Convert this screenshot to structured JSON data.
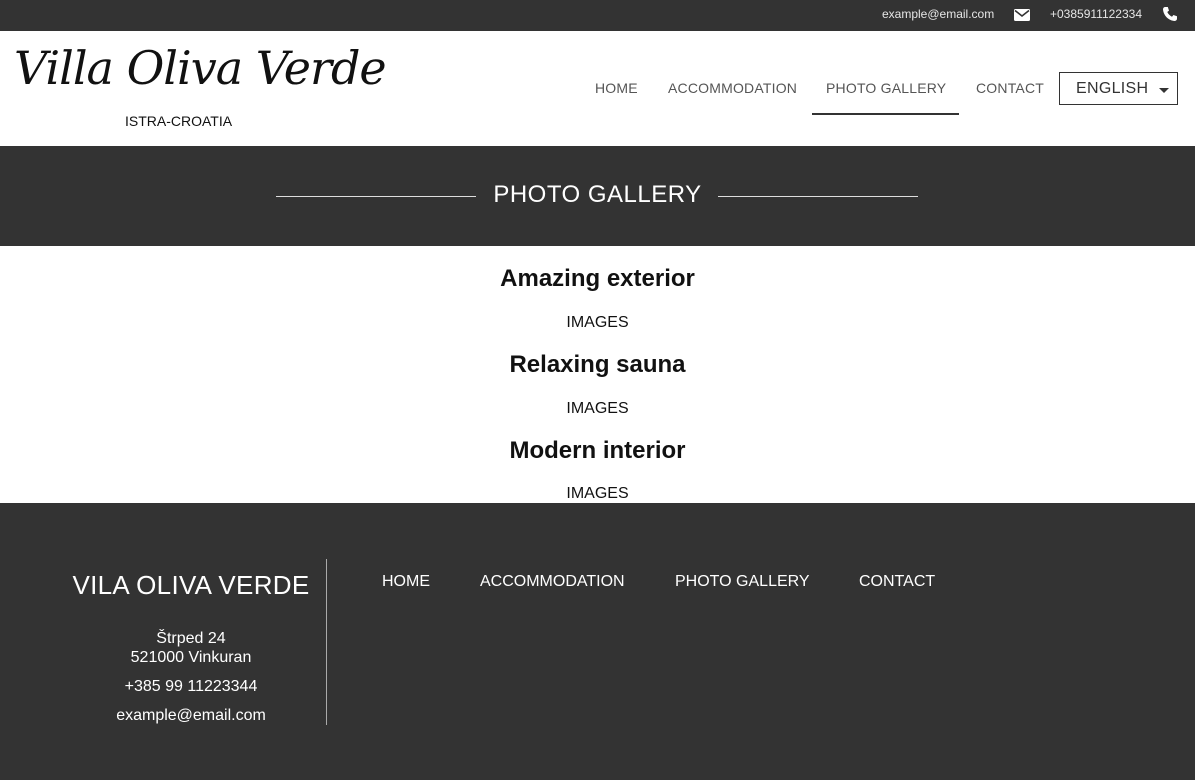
{
  "topbar": {
    "email": "example@email.com",
    "email_icon": "envelope-icon",
    "phone": "+0385911122334",
    "phone_icon": "phone-icon"
  },
  "header": {
    "logo": "Villa Oliva Verde",
    "logo_subtitle": "ISTRA-CROATIA",
    "nav": {
      "home": "HOME",
      "accommodation": "ACCOMMODATION",
      "gallery": "PHOTO GALLERY",
      "contact": "CONTACT",
      "active": "PHOTO GALLERY"
    },
    "language": {
      "selected": "ENGLISH",
      "icon": "chevron-down-icon"
    }
  },
  "banner": {
    "title": "PHOTO GALLERY"
  },
  "sections": [
    {
      "title": "Amazing exterior",
      "images_label": "IMAGES"
    },
    {
      "title": "Relaxing sauna",
      "images_label": "IMAGES"
    },
    {
      "title": "Modern interior",
      "images_label": "IMAGES"
    }
  ],
  "footer": {
    "brand": "VILA OLIVA VERDE",
    "address_line1": "Štrped 24",
    "address_line2": "521000 Vinkuran",
    "phone": "+385 99 11223344",
    "email": "example@email.com",
    "nav": {
      "home": "HOME",
      "accommodation": "ACCOMMODATION",
      "gallery": "PHOTO GALLERY",
      "contact": "CONTACT"
    }
  },
  "colors": {
    "dark": "#333333",
    "white": "#ffffff",
    "nav_text": "#555555"
  }
}
